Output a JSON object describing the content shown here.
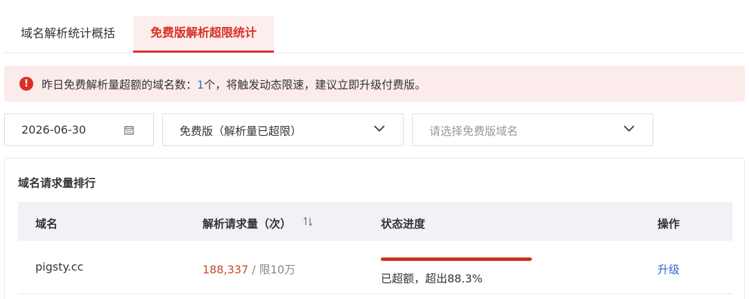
{
  "tabs": [
    {
      "label": "域名解析统计概括",
      "active": false
    },
    {
      "label": "免费版解析超限统计",
      "active": true
    }
  ],
  "alert": {
    "icon": "error-icon",
    "prefix": "昨日免费解析量超额的域名数：",
    "count": "1",
    "suffix": "个，将触发动态限速，建议立即升级付费版。"
  },
  "filters": {
    "date": "2026-06-30",
    "plan_type": "免费版（解析量已超限）",
    "domain_placeholder": "请选择免费版域名"
  },
  "card": {
    "title": "域名请求量排行",
    "columns": [
      "域名",
      "解析请求量（次）",
      "状态进度",
      "操作"
    ],
    "rows": [
      {
        "domain": "pigsty.cc",
        "requests": "188,337",
        "separator": "/",
        "limit": "限10万",
        "progress": 1.0,
        "status": "已超额，超出88.3%",
        "action": "升级"
      }
    ]
  },
  "colors": {
    "accent": "#d93026",
    "link": "#2e6ccf",
    "alert_bg": "#fcebeb",
    "progress": "#c9321f"
  }
}
